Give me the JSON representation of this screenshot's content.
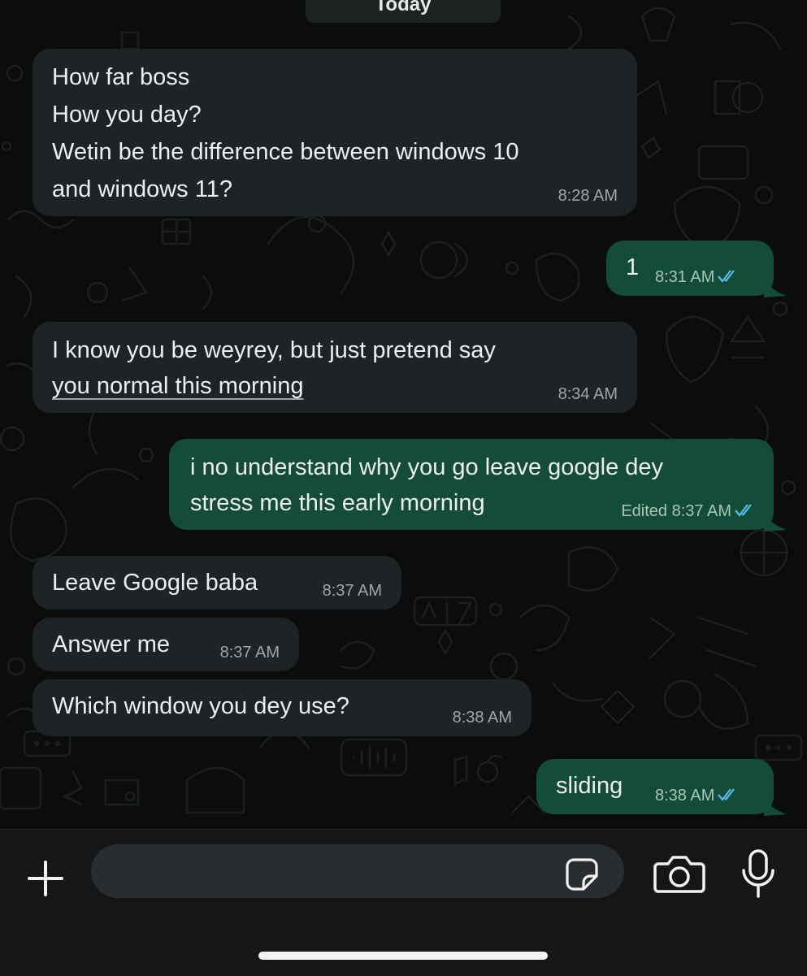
{
  "chat": {
    "date_label": "Today",
    "messages": [
      {
        "direction": "in",
        "lines": [
          "How far boss",
          "How you day?",
          "Wetin be the difference between windows 10",
          "and windows 11?"
        ],
        "time": "8:28 AM"
      },
      {
        "direction": "out",
        "text": "1",
        "time": "8:31 AM",
        "read": true
      },
      {
        "direction": "in",
        "lines": [
          "I know you be weyrey, but just pretend say",
          "you normal this morning"
        ],
        "time": "8:34 AM"
      },
      {
        "direction": "out",
        "lines": [
          "i no understand why you go leave google dey",
          "stress me this early morning"
        ],
        "time": "8:37 AM",
        "status_label": "Edited",
        "read": true
      },
      {
        "direction": "in",
        "text": "Leave Google baba",
        "time": "8:37 AM"
      },
      {
        "direction": "in",
        "text": "Answer me",
        "time": "8:37 AM"
      },
      {
        "direction": "in",
        "text": "Which window you dey use?",
        "time": "8:38 AM"
      },
      {
        "direction": "out",
        "text": "sliding",
        "time": "8:38 AM",
        "read": true
      }
    ]
  },
  "composer": {
    "message_value": "",
    "icons": {
      "attach": "plus-icon",
      "sticker": "sticker-icon",
      "camera": "camera-icon",
      "voice": "microphone-icon"
    }
  },
  "colors": {
    "background": "#0b0c0c",
    "incoming_bubble": "#1f2326",
    "outgoing_bubble": "#144d37",
    "read_ticks": "#53bdeb"
  }
}
